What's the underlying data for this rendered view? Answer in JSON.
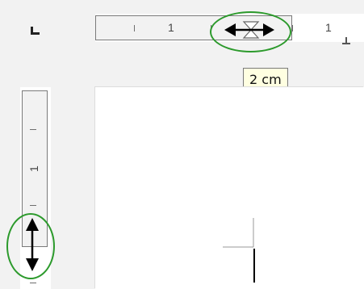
{
  "horizontal_ruler": {
    "tick_labels": [
      "1",
      "1"
    ]
  },
  "vertical_ruler": {
    "tick_labels": [
      "1"
    ]
  },
  "tooltip": {
    "text": "2 cm"
  },
  "highlight_color": "#2c9a2c",
  "icons": {
    "tab_stop": "tab-left-icon",
    "margin_handle_horizontal": "horizontal-resize-arrows-icon",
    "margin_handle_vertical": "vertical-resize-arrows-icon",
    "text_cursor": "text-cursor-icon"
  }
}
